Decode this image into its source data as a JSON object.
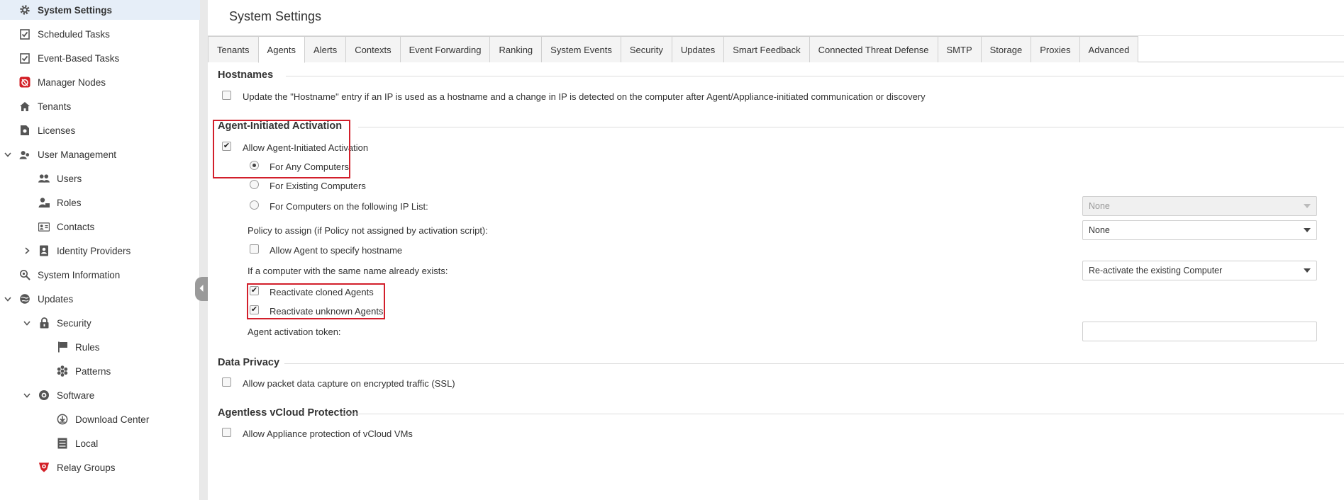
{
  "colors": {
    "highlight": "#d21f2b",
    "selected_bg": "#e6eef8"
  },
  "sidebar": {
    "items": [
      {
        "label": "System Settings",
        "icon": "gear-icon"
      },
      {
        "label": "Scheduled Tasks",
        "icon": "task-icon"
      },
      {
        "label": "Event-Based Tasks",
        "icon": "task-icon"
      },
      {
        "label": "Manager Nodes",
        "icon": "manager-node-icon"
      },
      {
        "label": "Tenants",
        "icon": "home-icon"
      },
      {
        "label": "Licenses",
        "icon": "license-icon"
      },
      {
        "label": "User Management",
        "icon": "users-icon"
      },
      {
        "label": "Users",
        "icon": "users-icon"
      },
      {
        "label": "Roles",
        "icon": "role-icon"
      },
      {
        "label": "Contacts",
        "icon": "contact-card-icon"
      },
      {
        "label": "Identity Providers",
        "icon": "identity-icon"
      },
      {
        "label": "System Information",
        "icon": "magnifier-icon"
      },
      {
        "label": "Updates",
        "icon": "globe-icon"
      },
      {
        "label": "Security",
        "icon": "lock-icon"
      },
      {
        "label": "Rules",
        "icon": "flag-icon"
      },
      {
        "label": "Patterns",
        "icon": "pattern-icon"
      },
      {
        "label": "Software",
        "icon": "disc-icon"
      },
      {
        "label": "Download Center",
        "icon": "download-icon"
      },
      {
        "label": "Local",
        "icon": "server-icon"
      },
      {
        "label": "Relay Groups",
        "icon": "relay-icon"
      }
    ]
  },
  "main": {
    "title": "System Settings",
    "tabs": [
      "Tenants",
      "Agents",
      "Alerts",
      "Contexts",
      "Event Forwarding",
      "Ranking",
      "System Events",
      "Security",
      "Updates",
      "Smart Feedback",
      "Connected Threat Defense",
      "SMTP",
      "Storage",
      "Proxies",
      "Advanced"
    ],
    "active_tab": "Agents",
    "hostnames": {
      "title": "Hostnames",
      "update_label": "Update the \"Hostname\" entry if an IP is used as a hostname and a change in IP is detected on the computer after Agent/Appliance-initiated communication or discovery",
      "update_checked": false
    },
    "activation": {
      "title": "Agent-Initiated Activation",
      "allow_label": "Allow Agent-Initiated Activation",
      "allow_checked": true,
      "radio_any": "For Any Computers",
      "radio_existing": "For Existing Computers",
      "radio_iplist": "For Computers on the following IP List:",
      "selected_radio": "For Any Computers",
      "iplist_value": "None",
      "policy_label": "Policy to assign (if Policy not assigned by activation script):",
      "policy_value": "None",
      "hostname_label": "Allow Agent to specify hostname",
      "hostname_checked": false,
      "same_name_label": "If a computer with the same name already exists:",
      "same_name_value": "Re-activate the existing Computer",
      "cloned_label": "Reactivate cloned Agents",
      "cloned_checked": true,
      "unknown_label": "Reactivate unknown Agents",
      "unknown_checked": true,
      "token_label": "Agent activation token:",
      "token_value": ""
    },
    "privacy": {
      "title": "Data Privacy",
      "ssl_label": "Allow packet data capture on encrypted traffic (SSL)",
      "ssl_checked": false
    },
    "vcloud": {
      "title": "Agentless vCloud Protection",
      "label": "Allow Appliance protection of vCloud VMs",
      "checked": false
    },
    "check_glyph": "✔"
  }
}
